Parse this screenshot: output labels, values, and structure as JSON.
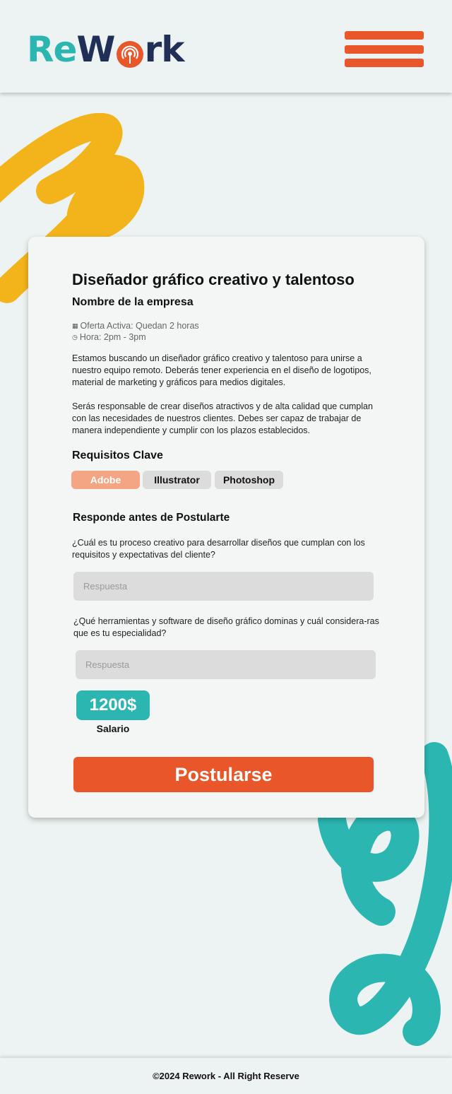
{
  "brand": {
    "logo_part1": "Re",
    "logo_part2": "W",
    "logo_part3": "rk"
  },
  "colors": {
    "accent": "#e8562a",
    "teal": "#2bb6b1",
    "navy": "#1f2f58",
    "yellow": "#f3b31b",
    "chip_active": "#f3a584"
  },
  "header": {
    "menu_icon": "hamburger-menu-icon"
  },
  "job": {
    "title": "Diseñador gráfico creativo y talentoso",
    "company": "Nombre de la empresa",
    "status": "Oferta Activa: Quedan 2 horas",
    "hours": "Hora: 2pm - 3pm",
    "description_1": "Estamos buscando un diseñador gráfico creativo y talentoso para unirse a nuestro equipo remoto. Deberás tener experiencia en el diseño de logotipos, material de marketing y gráficos para medios digitales.",
    "description_2": "Serás responsable de crear diseños atractivos y de alta calidad que cumplan con las necesidades de nuestros clientes. Debes ser capaz de trabajar de manera independiente y cumplir con los plazos establecidos."
  },
  "requirements": {
    "heading": "Requisitos Clave",
    "tags": [
      {
        "label": "Adobe",
        "active": true
      },
      {
        "label": "Illustrator",
        "active": false
      },
      {
        "label": "Photoshop",
        "active": false
      }
    ]
  },
  "questions": {
    "heading": "Responde antes de Postularte",
    "items": [
      {
        "question": "¿Cuál es tu proceso creativo para desarrollar diseños que cumplan con los requisitos y expectativas del cliente?",
        "placeholder": "Respuesta"
      },
      {
        "question": "¿Qué herramientas y software de diseño gráfico dominas y cuál considera-ras que es tu especialidad?",
        "placeholder": "Respuesta"
      }
    ]
  },
  "salary": {
    "amount": "1200$",
    "label": "Salario"
  },
  "apply_label": "Postularse",
  "footer": "©2024 Rework - All Right Reserve"
}
